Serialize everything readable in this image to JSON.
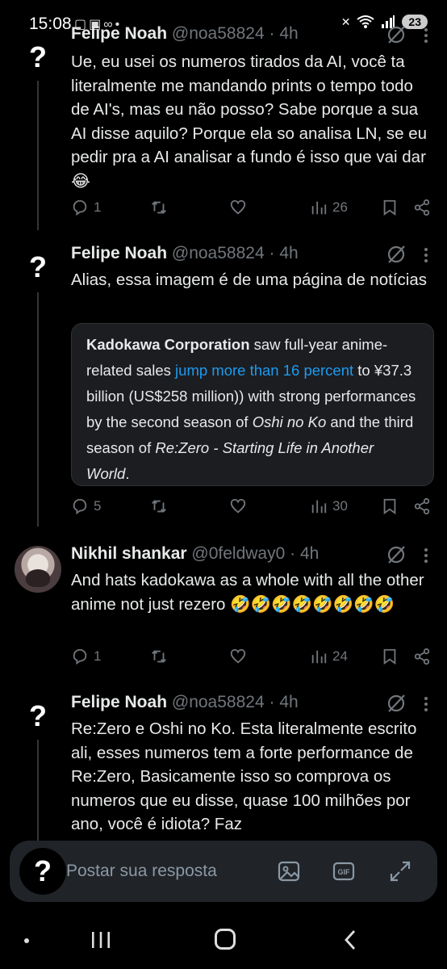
{
  "status_bar": {
    "time": "15:08",
    "left_icons": [
      "notification-icon",
      "gallery-icon",
      "voicemail-icon",
      "dot-icon"
    ],
    "right_icons": [
      "mute-icon",
      "wifi-icon",
      "signal-icon"
    ],
    "battery": "23"
  },
  "posts": [
    {
      "name": "Felipe Noah",
      "handle": "@noa58824",
      "separator": "·",
      "time": "4h",
      "avatar_symbol": "?",
      "text": "Ue, eu usei os numeros tirados da AI,  você ta literalmente me mandando prints o tempo todo de AI's, mas eu não posso? Sabe porque a sua AI disse aquilo? Porque ela so analisa LN, se eu pedir pra a AI analisar a fundo é isso que vai dar 😂",
      "replies": "1",
      "views": "26"
    },
    {
      "name": "Felipe Noah",
      "handle": "@noa58824",
      "separator": "·",
      "time": "4h",
      "avatar_symbol": "?",
      "text": "Alias, essa imagem é de uma página de notícias",
      "quote": {
        "strong": "Kadokawa Corporation",
        "t1": " saw full-year anime-related sales ",
        "link": "jump more than 16 percent",
        "t2": " to ¥37.3 billion (US$258 million)) with strong performances by the second season of ",
        "em1": "Oshi no Ko",
        "t3": " and the third season of ",
        "em2": "Re:Zero - Starting Life in Another World",
        "t4": "."
      },
      "replies": "5",
      "views": "30"
    },
    {
      "name": "Nikhil shankar",
      "handle": "@0feldway0",
      "separator": "·",
      "time": "4h",
      "text": "And hats kadokawa as a whole with all the other anime not just rezero 🤣🤣🤣🤣🤣🤣🤣🤣",
      "replies": "1",
      "views": "24"
    },
    {
      "name": "Felipe Noah",
      "handle": "@noa58824",
      "separator": "·",
      "time": "4h",
      "avatar_symbol": "?",
      "text": "Re:Zero e Oshi no Ko. Esta literalmente escrito ali, esses numeros tem a forte performance de Re:Zero, Basicamente isso so comprova os numeros que eu disse, quase 100 milhões por ano, você é idiota? Faz"
    }
  ],
  "composer": {
    "avatar_symbol": "?",
    "placeholder": "Postar sua resposta"
  },
  "colors": {
    "background": "#000000",
    "text": "#e7e9ea",
    "secondary": "#71767b",
    "link": "#1d9bf0",
    "quote_bg": "#1c1d21",
    "composer_bg": "#202327"
  }
}
